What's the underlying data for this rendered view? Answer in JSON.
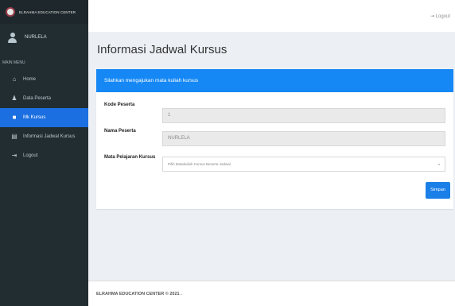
{
  "brand": {
    "name": "ELRAHMA EDUCATION CENTER"
  },
  "user": {
    "name": "NURLELA"
  },
  "sidebar": {
    "header": "MAIN MENU",
    "items": [
      {
        "label": "Home",
        "icon": "home-icon",
        "glyph": "⌂"
      },
      {
        "label": "Data Peserta",
        "icon": "user-icon",
        "glyph": "♟"
      },
      {
        "label": "Mk Kursus",
        "icon": "book-icon",
        "glyph": "■",
        "active": true
      },
      {
        "label": "Informasi Jadwal Kursus",
        "icon": "list-icon",
        "glyph": "▤"
      },
      {
        "label": "Logout",
        "icon": "logout-icon",
        "glyph": "⇥"
      }
    ]
  },
  "topbar": {
    "logout_label": "Logout",
    "logout_glyph": "⇥"
  },
  "page": {
    "title": "Informasi Jadwal Kursus"
  },
  "form": {
    "header": "Silahkan mengajukan mata kuliah kursus",
    "fields": {
      "kode": {
        "label": "Kode Peserta",
        "value": "1"
      },
      "nama": {
        "label": "Nama Peserta",
        "value": "NURLELA"
      },
      "mapel": {
        "label": "Mata Pelajaran Kursus",
        "placeholder": "Pilih Matakuliah Kursus Beserta Jadwal",
        "caret": "▾"
      }
    },
    "submit_label": "Simpan"
  },
  "footer": {
    "text": "ELRAHMA EDUCATION CENTER © 2021 ."
  },
  "colors": {
    "sidebar": "#222d32",
    "active": "#1b6fe0",
    "header": "#1588f5",
    "button": "#1b7fe8"
  }
}
